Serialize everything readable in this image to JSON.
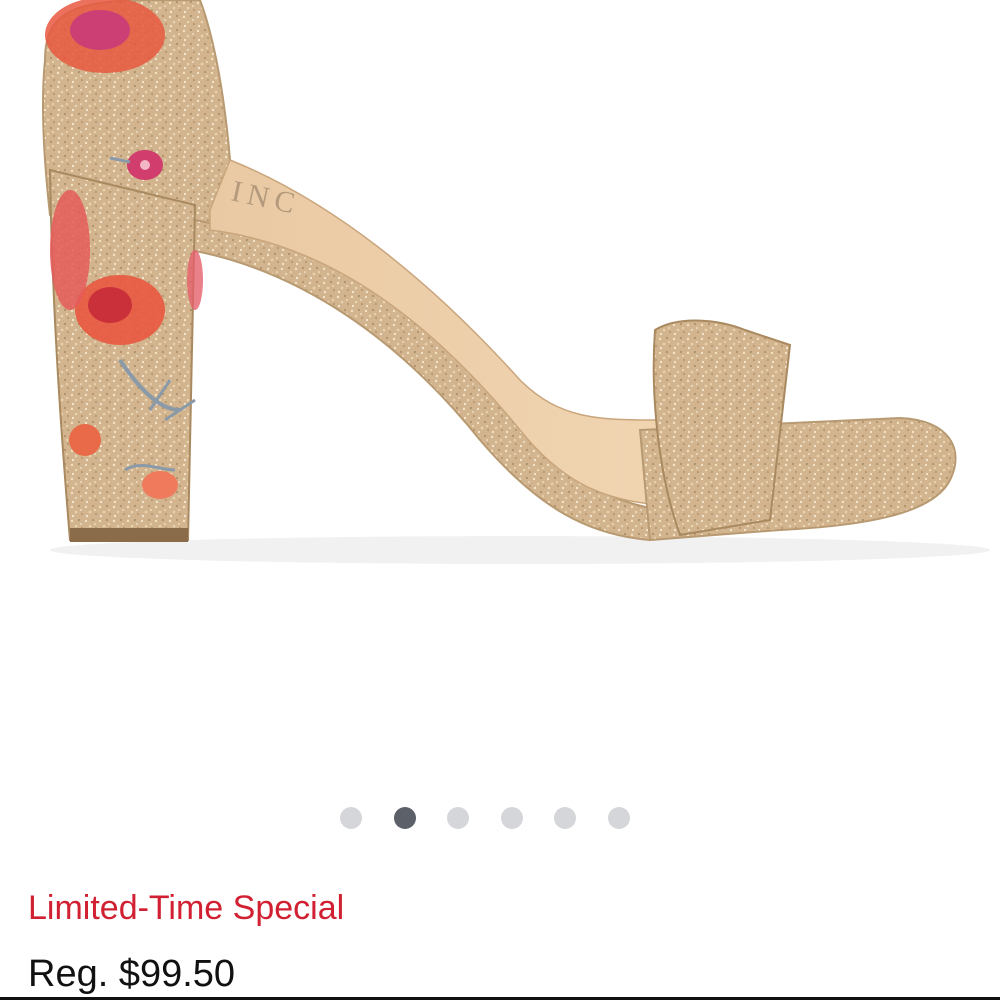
{
  "product": {
    "image_alt": "Gold glitter block-heel sandal with floral embroidered heel",
    "brand_mark": "INC",
    "carousel": {
      "total": 6,
      "active_index": 1
    },
    "promo_label": "Limited-Time Special",
    "reg_price": "Reg. $99.50"
  },
  "colors": {
    "promo": "#d12031",
    "dot_inactive": "#d5d6d9",
    "dot_active": "#5c6068",
    "glitter_gold": "#d6b98f"
  }
}
